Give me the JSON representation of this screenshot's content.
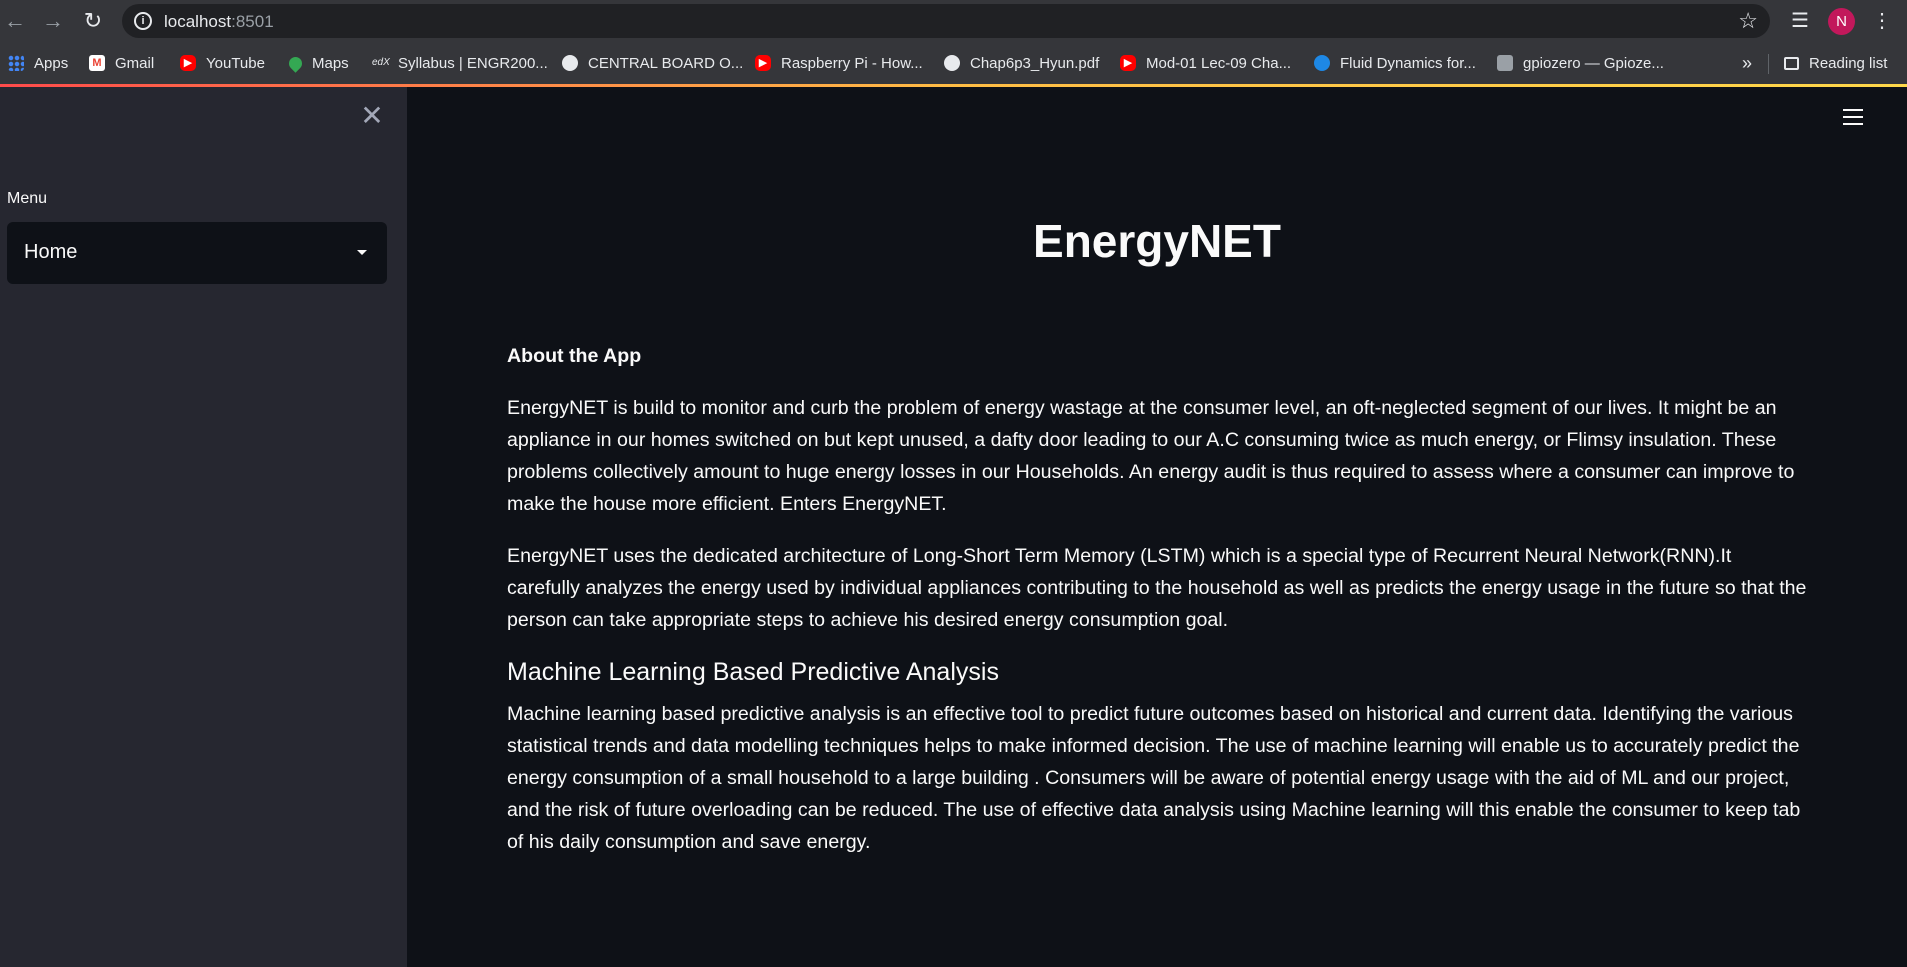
{
  "browser": {
    "url_host": "localhost",
    "url_port": ":8501",
    "avatar_letter": "N",
    "bookmarks": [
      {
        "label": "Apps",
        "icon": "apps-icon"
      },
      {
        "label": "Gmail",
        "icon": "gmail-icon"
      },
      {
        "label": "YouTube",
        "icon": "youtube-icon"
      },
      {
        "label": "Maps",
        "icon": "maps-icon"
      },
      {
        "label": "Syllabus | ENGR200...",
        "icon": "edx-icon"
      },
      {
        "label": "CENTRAL BOARD O...",
        "icon": "globe-icon"
      },
      {
        "label": "Raspberry Pi - How...",
        "icon": "youtube-icon"
      },
      {
        "label": "Chap6p3_Hyun.pdf",
        "icon": "globe-icon"
      },
      {
        "label": "Mod-01 Lec-09 Cha...",
        "icon": "youtube-icon"
      },
      {
        "label": "Fluid Dynamics for...",
        "icon": "fluid-icon"
      },
      {
        "label": "gpiozero — Gpioze...",
        "icon": "gpiozero-icon"
      }
    ],
    "bookmarks_overflow": "»",
    "reading_list": "Reading list"
  },
  "sidebar": {
    "menu_label": "Menu",
    "selected_option": "Home"
  },
  "main": {
    "title": "EnergyNET",
    "about_heading": "About the App",
    "about_p1": "EnergyNET is build to monitor and curb the problem of energy wastage at the consumer level, an oft-neglected segment of our lives. It might be an appliance in our homes switched on but kept unused, a dafty door leading to our A.C consuming twice as much energy, or Flimsy insulation. These problems collectively amount to huge energy losses in our Households. An energy audit is thus required to assess where a consumer can improve to make the house more efficient. Enters EnergyNET.",
    "about_p2": "EnergyNET uses the dedicated architecture of Long-Short Term Memory (LSTM) which is a special type of Recurrent Neural Network(RNN).It carefully analyzes the energy used by individual appliances contributing to the household as well as predicts the energy usage in the future so that the person can take appropriate steps to achieve his desired energy consumption goal.",
    "ml_heading": "Machine Learning Based Predictive Analysis",
    "ml_p": "Machine learning based predictive analysis is an effective tool to predict future outcomes based on historical and current data. Identifying the various statistical trends and data modelling techniques helps to make informed decision. The use of machine learning will enable us to accurately predict the energy consumption of a small household to a large building . Consumers will be aware of potential energy usage with the aid of ML and our project, and the risk of future overloading can be reduced. The use of effective data analysis using Machine learning will this enable the consumer to keep tab of his daily consumption and save energy."
  },
  "colors": {
    "background": "#0e1117",
    "sidebar": "#262730",
    "text": "#fafafa",
    "accent_gradient": [
      "#ff4b4b",
      "#ffbd45",
      "#ffd84a"
    ]
  }
}
